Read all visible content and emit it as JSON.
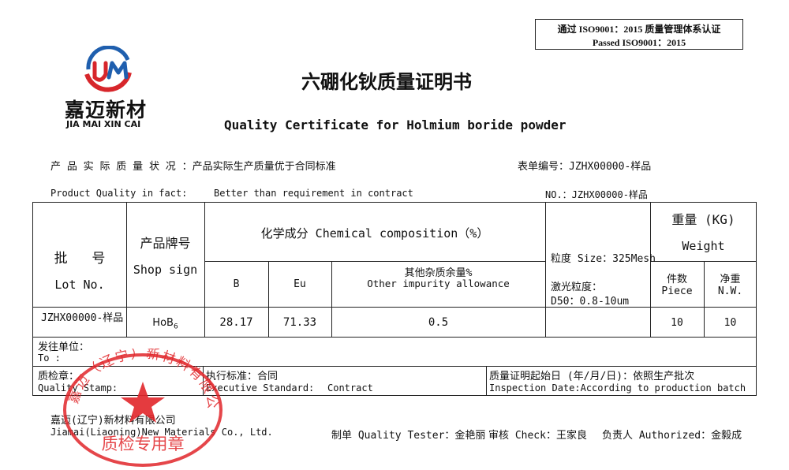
{
  "header": {
    "iso_line1": "通过 ISO9001：2015 质量管理体系认证",
    "iso_line2": "Passed   ISO9001：2015",
    "logo_cn": "嘉迈新材",
    "logo_en": "JIA MAI XIN CAI",
    "title_cn": "六硼化钬质量证明书",
    "title_en": "Quality Certificate for Holmium boride powder"
  },
  "info": {
    "quality_status_cn": "产 品 实 际 质 量 状 况 ：产品实际生产质量优于合同标准",
    "form_no_cn": "表单编号：JZHX00000-样品",
    "quality_label_en": "Product Quality in fact:",
    "quality_value_en": "Better than requirement in contract",
    "no_en": "NO.：JZHX00000-样品"
  },
  "table": {
    "lot_cn": "批   号",
    "lot_en": "Lot No.",
    "shop_cn": "产品牌号",
    "shop_en": "Shop sign",
    "chem_header": "化学成分 Chemical composition（%）",
    "col_b": "B",
    "col_eu": "Eu",
    "impurity_cn": "其他杂质余量%",
    "impurity_en": "Other impurity allowance",
    "size_label": "粒度 Size：325Mesh",
    "laser_label": "激光粒度：",
    "laser_value": "D50：0.8-10um",
    "weight_cn": "重量 (KG)",
    "weight_en": "Weight",
    "piece_cn": "件数",
    "piece_en": "Piece",
    "nw_cn": "净重",
    "nw_en": "N.W.",
    "row": {
      "lot": "JZHX00000-样品",
      "shop_main": "HoB",
      "shop_sub": "6",
      "b": "28.17",
      "eu": "71.33",
      "impurity": "0.5",
      "piece": "10",
      "nw": "10"
    },
    "ship_to_cn": "发往单位：",
    "ship_to_en": "To :",
    "stamp_cn": "质检章：",
    "stamp_en": "Quality Stamp:",
    "exec_cn": "执行标准：合同",
    "exec_label_en": "Executive Standard:",
    "exec_value_en": "Contract",
    "date_cn": "质量证明起始日 (年/月/日)：依照生产批次",
    "date_en": "Inspection Date:According to production batch"
  },
  "footer": {
    "company_cn": "嘉迈(辽宁)新材料有限公司",
    "company_en": "Jiamai(Liaoning)New Materials Co., Ltd.",
    "tester": "制单 Quality Tester：金艳丽",
    "check": "审核 Check：王家良",
    "authorized": "负责人 Authorized：金毅成"
  },
  "stamp": {
    "text": "嘉迈（辽宁）新材料有限公司",
    "bottom_text": "质检专用章"
  },
  "colors": {
    "logo_blue": "#1f5fae",
    "logo_red": "#d7262b",
    "stamp_red": "#e1262a"
  }
}
